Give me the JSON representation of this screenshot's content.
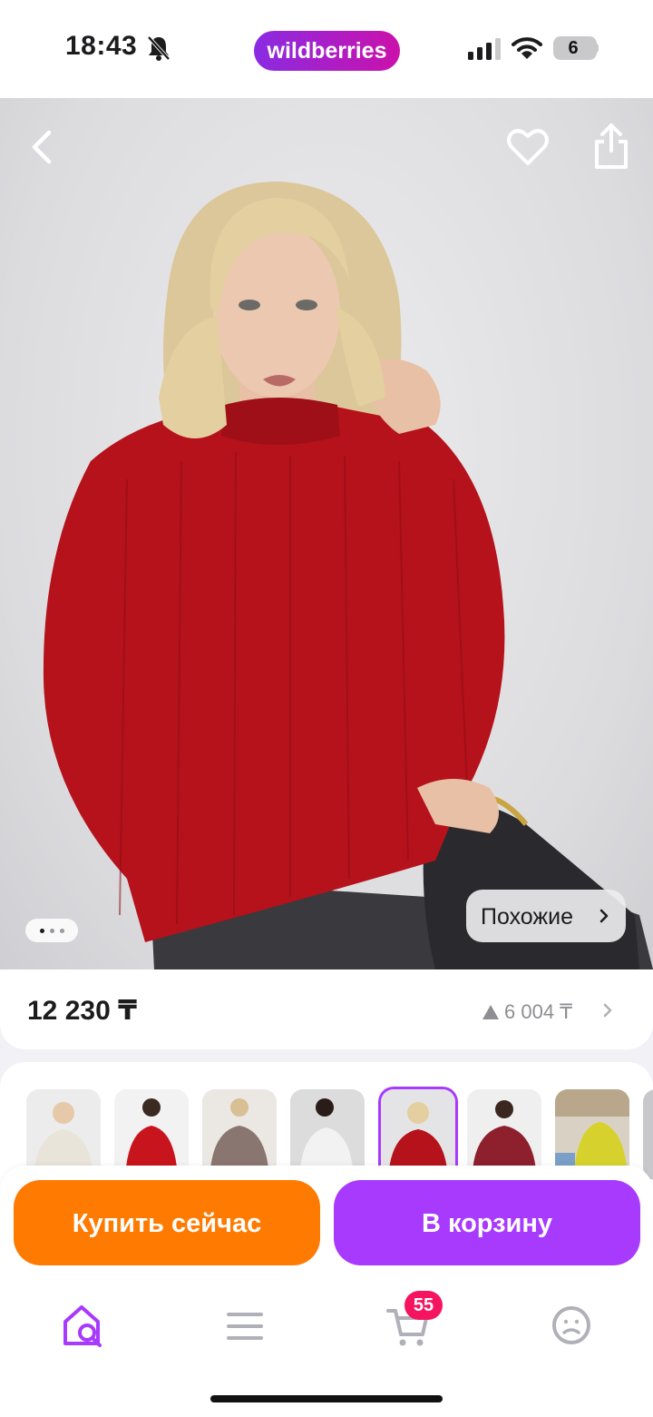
{
  "status_bar": {
    "time": "18:43",
    "brand": "wildberries",
    "battery": "6",
    "icons": [
      "bell-slash-icon",
      "cellular-signal-icon",
      "wifi-icon",
      "battery-icon"
    ]
  },
  "product": {
    "photo_icons": [
      "back-arrow-icon",
      "heart-icon",
      "share-icon"
    ],
    "similar_label": "Похожие",
    "gallery_pages": 3,
    "gallery_active": 1,
    "price": "12 230 ₸",
    "rating_text": "6 004 ₸"
  },
  "variants": [
    {
      "name": "cream",
      "color": "#e8e4da",
      "selected": false
    },
    {
      "name": "red",
      "color": "#c8141c",
      "selected": false
    },
    {
      "name": "mocha",
      "color": "#8a7670",
      "selected": false
    },
    {
      "name": "white",
      "color": "#f2f2f2",
      "selected": false
    },
    {
      "name": "red-current",
      "color": "#b5121b",
      "selected": true
    },
    {
      "name": "burgundy",
      "color": "#8e1f2c",
      "selected": false
    },
    {
      "name": "yellow",
      "color": "#d6d12c",
      "selected": false
    }
  ],
  "actions": {
    "buy_now": "Купить сейчас",
    "add_to_cart": "В корзину"
  },
  "tab_bar": {
    "items": [
      "home-search-icon",
      "catalog-menu-icon",
      "cart-icon",
      "profile-icon"
    ],
    "cart_badge": "55",
    "active": "home-search-icon"
  },
  "colors": {
    "accent": "#a73afd",
    "buy_now": "#ff7a00",
    "badge": "#f5145f",
    "sweater": "#b5121b"
  }
}
